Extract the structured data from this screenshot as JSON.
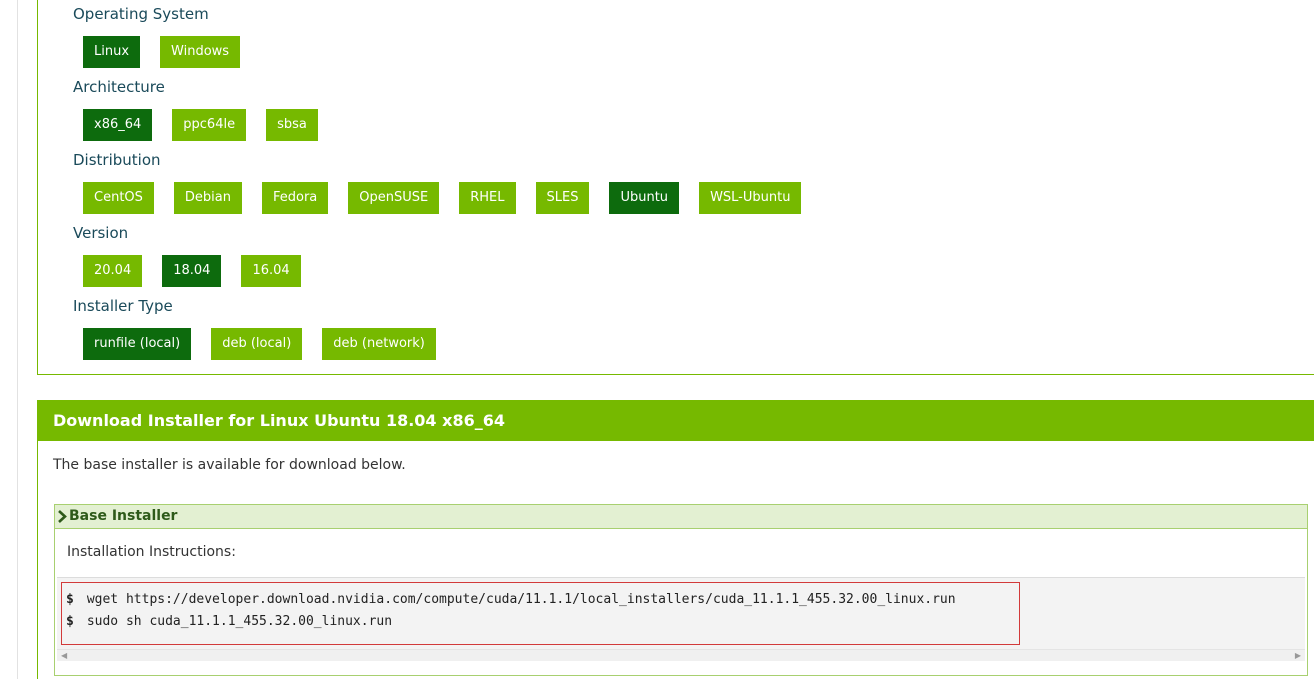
{
  "selector": {
    "rows": [
      {
        "label": "Operating System",
        "options": [
          "Linux",
          "Windows"
        ],
        "selected": "Linux"
      },
      {
        "label": "Architecture",
        "options": [
          "x86_64",
          "ppc64le",
          "sbsa"
        ],
        "selected": "x86_64"
      },
      {
        "label": "Distribution",
        "options": [
          "CentOS",
          "Debian",
          "Fedora",
          "OpenSUSE",
          "RHEL",
          "SLES",
          "Ubuntu",
          "WSL-Ubuntu"
        ],
        "selected": "Ubuntu"
      },
      {
        "label": "Version",
        "options": [
          "20.04",
          "18.04",
          "16.04"
        ],
        "selected": "18.04"
      },
      {
        "label": "Installer Type",
        "options": [
          "runfile (local)",
          "deb (local)",
          "deb (network)"
        ],
        "selected": "runfile (local)"
      }
    ]
  },
  "download": {
    "title": "Download Installer for Linux Ubuntu 18.04 x86_64",
    "description": "The base installer is available for download below.",
    "base_installer": {
      "heading": "Base Installer",
      "instructions_label": "Installation Instructions:",
      "prompt": "$",
      "commands": [
        "wget https://developer.download.nvidia.com/compute/cuda/11.1.1/local_installers/cuda_11.1.1_455.32.00_linux.run",
        "sudo sh cuda_11.1.1_455.32.00_linux.run"
      ]
    }
  },
  "colors": {
    "accent": "#76b900",
    "selected": "#0d6b0d",
    "highlight_border": "#d23a3a"
  },
  "icons": {
    "expand": "chevron-right-icon",
    "scroll_left": "scroll-left-arrow-icon",
    "scroll_right": "scroll-right-arrow-icon"
  }
}
